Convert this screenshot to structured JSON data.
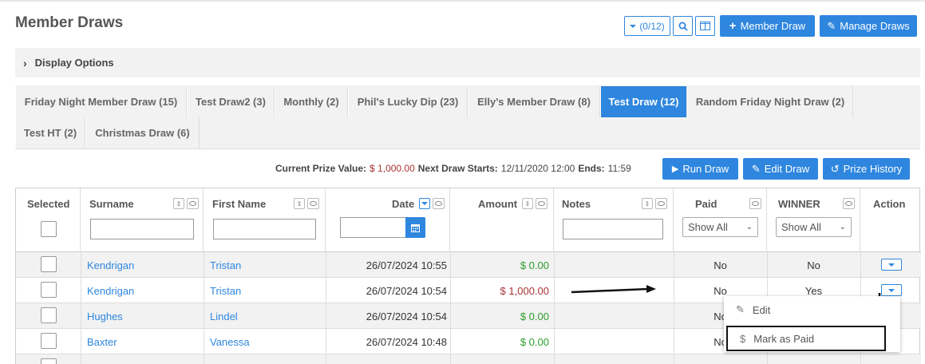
{
  "page": {
    "title": "Member Draws"
  },
  "toolbar": {
    "filter_count": "(0/12)",
    "member_draw_label": "Member Draw",
    "manage_draws_label": "Manage Draws"
  },
  "display_options": {
    "label": "Display Options"
  },
  "tabs": [
    {
      "label": "Friday Night Member Draw (15)"
    },
    {
      "label": "Test Draw2 (3)"
    },
    {
      "label": "Monthly (2)"
    },
    {
      "label": "Phil's Lucky Dip (23)"
    },
    {
      "label": "Elly's Member Draw (8)"
    },
    {
      "label": "Test Draw (12)",
      "active": true
    },
    {
      "label": "Random Friday Night Draw (2)"
    },
    {
      "label": "Test HT (2)"
    },
    {
      "label": "Christmas Draw (6)"
    }
  ],
  "prize": {
    "current_label": "Current Prize Value:",
    "current_value": "$ 1,000.00",
    "next_label": "Next Draw Starts:",
    "next_value": "12/11/2020 12:00",
    "ends_label": "Ends:",
    "ends_value": "11:59",
    "run_draw_label": "Run Draw",
    "edit_draw_label": "Edit Draw",
    "prize_history_label": "Prize History"
  },
  "table": {
    "headers": {
      "selected": "Selected",
      "surname": "Surname",
      "first_name": "First Name",
      "date": "Date",
      "amount": "Amount",
      "notes": "Notes",
      "paid": "Paid",
      "winner": "WINNER",
      "action": "Action"
    },
    "paid_filter": "Show All",
    "winner_filter": "Show All",
    "rows": [
      {
        "surname": "Kendrigan",
        "first_name": "Tristan",
        "date": "26/07/2024 10:55",
        "amount": "$ 0.00",
        "paid": "No",
        "winner": "No"
      },
      {
        "surname": "Kendrigan",
        "first_name": "Tristan",
        "date": "26/07/2024 10:54",
        "amount": "$ 1,000.00",
        "paid": "No",
        "winner": "Yes"
      },
      {
        "surname": "Hughes",
        "first_name": "Lindel",
        "date": "26/07/2024 10:54",
        "amount": "$ 0.00",
        "paid": "No",
        "winner": ""
      },
      {
        "surname": "Baxter",
        "first_name": "Vanessa",
        "date": "26/07/2024 10:48",
        "amount": "$ 0.00",
        "paid": "No",
        "winner": ""
      }
    ]
  },
  "action_menu": {
    "edit_label": "Edit",
    "mark_paid_label": "Mark as Paid"
  },
  "colors": {
    "accent": "#2e86de",
    "positive": "#2a9d2a",
    "negative": "#aa3333"
  }
}
